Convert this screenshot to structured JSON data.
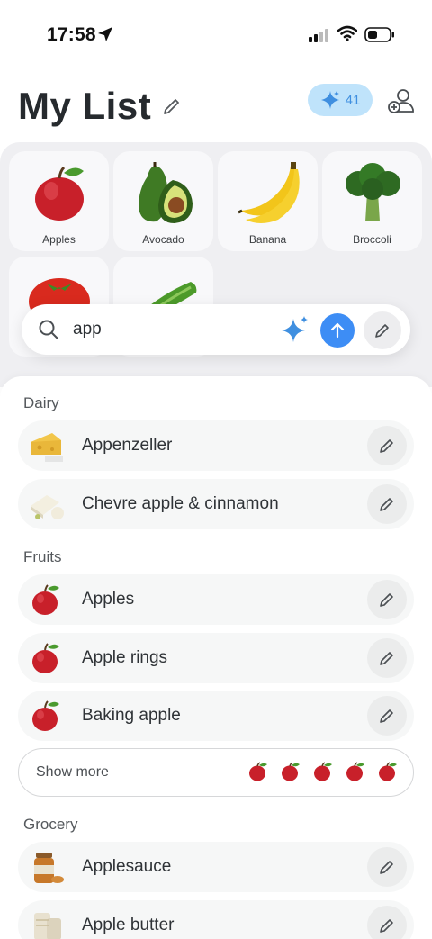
{
  "status_bar": {
    "time": "17:58"
  },
  "header": {
    "title": "My List",
    "credits": "41"
  },
  "grid": {
    "tiles": [
      {
        "label": "Apples",
        "icon": "apple-icon"
      },
      {
        "label": "Avocado",
        "icon": "avocado-icon"
      },
      {
        "label": "Banana",
        "icon": "banana-icon"
      },
      {
        "label": "Broccoli",
        "icon": "broccoli-icon"
      },
      {
        "label": "",
        "icon": "tomato-icon"
      },
      {
        "label": "",
        "icon": "cucumber-icon"
      }
    ]
  },
  "search": {
    "value": "app"
  },
  "sections": [
    {
      "title": "Dairy",
      "items": [
        {
          "label": "Appenzeller",
          "icon": "cheese-icon"
        },
        {
          "label": "Chevre apple & cinnamon",
          "icon": "goat-cheese-icon"
        }
      ]
    },
    {
      "title": "Fruits",
      "items": [
        {
          "label": "Apples",
          "icon": "apple-icon"
        },
        {
          "label": "Apple rings",
          "icon": "apple-icon"
        },
        {
          "label": "Baking apple",
          "icon": "apple-icon"
        }
      ],
      "show_more": "Show more"
    },
    {
      "title": "Grocery",
      "items": [
        {
          "label": "Applesauce",
          "icon": "jar-icon"
        },
        {
          "label": "Apple butter",
          "icon": "jar-icon"
        }
      ]
    }
  ],
  "colors": {
    "accent": "#3d8df5",
    "credit_bg": "#bfe3fb",
    "tray_bg": "#efeff2"
  }
}
